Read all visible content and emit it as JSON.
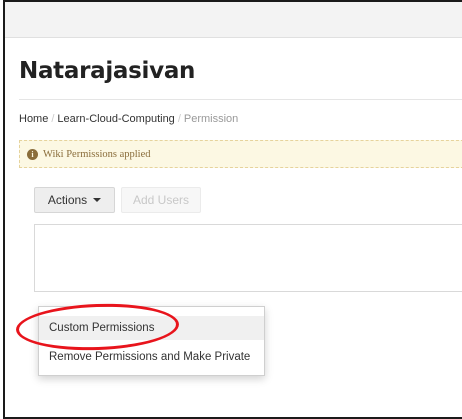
{
  "header": {
    "title": "Natarajasivan"
  },
  "breadcrumb": {
    "home": "Home",
    "separator": "/",
    "wiki": "Learn-Cloud-Computing",
    "current": "Permission"
  },
  "alert": {
    "icon": "info-circle-icon",
    "icon_glyph": "i",
    "text": "Wiki Permissions applied"
  },
  "toolbar": {
    "actions_label": "Actions",
    "add_users_label": "Add Users"
  },
  "dropdown": {
    "items": [
      {
        "label": "Custom Permissions",
        "highlighted": true
      },
      {
        "label": "Remove Permissions and Make Private",
        "highlighted": false
      }
    ]
  },
  "annotation": {
    "color": "#e8141c"
  }
}
